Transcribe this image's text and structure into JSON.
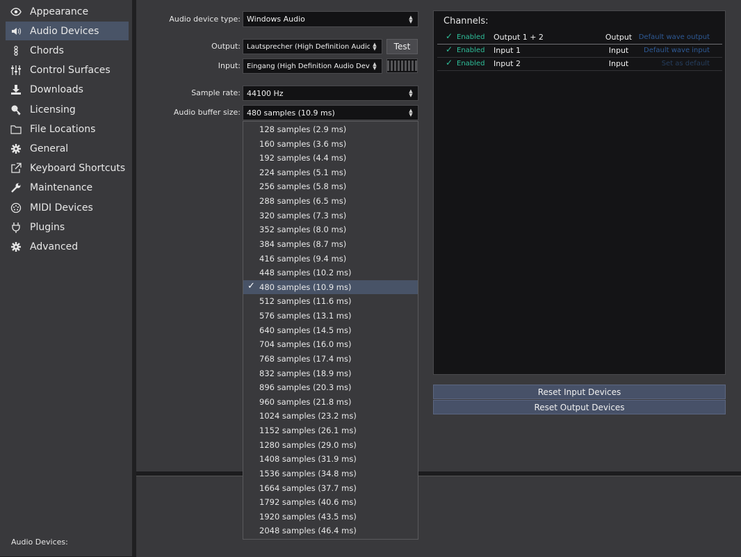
{
  "sidebar": {
    "items": [
      {
        "label": "Appearance",
        "icon": "eye-icon"
      },
      {
        "label": "Audio Devices",
        "icon": "speaker-icon",
        "selected": true
      },
      {
        "label": "Chords",
        "icon": "chords-icon"
      },
      {
        "label": "Control Surfaces",
        "icon": "sliders-icon"
      },
      {
        "label": "Downloads",
        "icon": "download-icon"
      },
      {
        "label": "Licensing",
        "icon": "key-icon"
      },
      {
        "label": "File Locations",
        "icon": "folder-icon"
      },
      {
        "label": "General",
        "icon": "gear-icon"
      },
      {
        "label": "Keyboard Shortcuts",
        "icon": "external-link-icon"
      },
      {
        "label": "Maintenance",
        "icon": "wrench-icon"
      },
      {
        "label": "MIDI Devices",
        "icon": "midi-icon"
      },
      {
        "label": "Plugins",
        "icon": "plug-icon"
      },
      {
        "label": "Advanced",
        "icon": "gear-icon"
      }
    ],
    "footer": "Audio Devices:"
  },
  "settings": {
    "device_type_label": "Audio device type:",
    "device_type_value": "Windows Audio",
    "output_label": "Output:",
    "output_value": "Lautsprecher (High Definition Audio Device)",
    "test_label": "Test",
    "input_label": "Input:",
    "input_value": "Eingang (High Definition Audio Device)",
    "sample_rate_label": "Sample rate:",
    "sample_rate_value": "44100 Hz",
    "buffer_label": "Audio buffer size:",
    "buffer_value": "480 samples (10.9 ms)"
  },
  "buffer_options": [
    "128 samples (2.9 ms)",
    "160 samples (3.6 ms)",
    "192 samples (4.4 ms)",
    "224 samples (5.1 ms)",
    "256 samples (5.8 ms)",
    "288 samples (6.5 ms)",
    "320 samples (7.3 ms)",
    "352 samples (8.0 ms)",
    "384 samples (8.7 ms)",
    "416 samples (9.4 ms)",
    "448 samples (10.2 ms)",
    "480 samples (10.9 ms)",
    "512 samples (11.6 ms)",
    "576 samples (13.1 ms)",
    "640 samples (14.5 ms)",
    "704 samples (16.0 ms)",
    "768 samples (17.4 ms)",
    "832 samples (18.9 ms)",
    "896 samples (20.3 ms)",
    "960 samples (21.8 ms)",
    "1024 samples (23.2 ms)",
    "1152 samples (26.1 ms)",
    "1280 samples (29.0 ms)",
    "1408 samples (31.9 ms)",
    "1536 samples (34.8 ms)",
    "1664 samples (37.7 ms)",
    "1792 samples (40.6 ms)",
    "1920 samples (43.5 ms)",
    "2048 samples (46.4 ms)"
  ],
  "buffer_selected_index": 11,
  "channels": {
    "title": "Channels:",
    "rows": [
      {
        "enabled": "Enabled",
        "name": "Output 1 + 2",
        "type": "Output",
        "action": "Default wave output"
      },
      {
        "enabled": "Enabled",
        "name": "Input 1",
        "type": "Input",
        "action": "Default wave input"
      },
      {
        "enabled": "Enabled",
        "name": "Input 2",
        "type": "Input",
        "action": "Set as default"
      }
    ]
  },
  "buttons": {
    "reset_input": "Reset Input Devices",
    "reset_output": "Reset Output Devices"
  },
  "colors": {
    "accent_selected": "#495467",
    "enabled_green": "#2ebf9a",
    "link_blue": "#2e5a96"
  }
}
